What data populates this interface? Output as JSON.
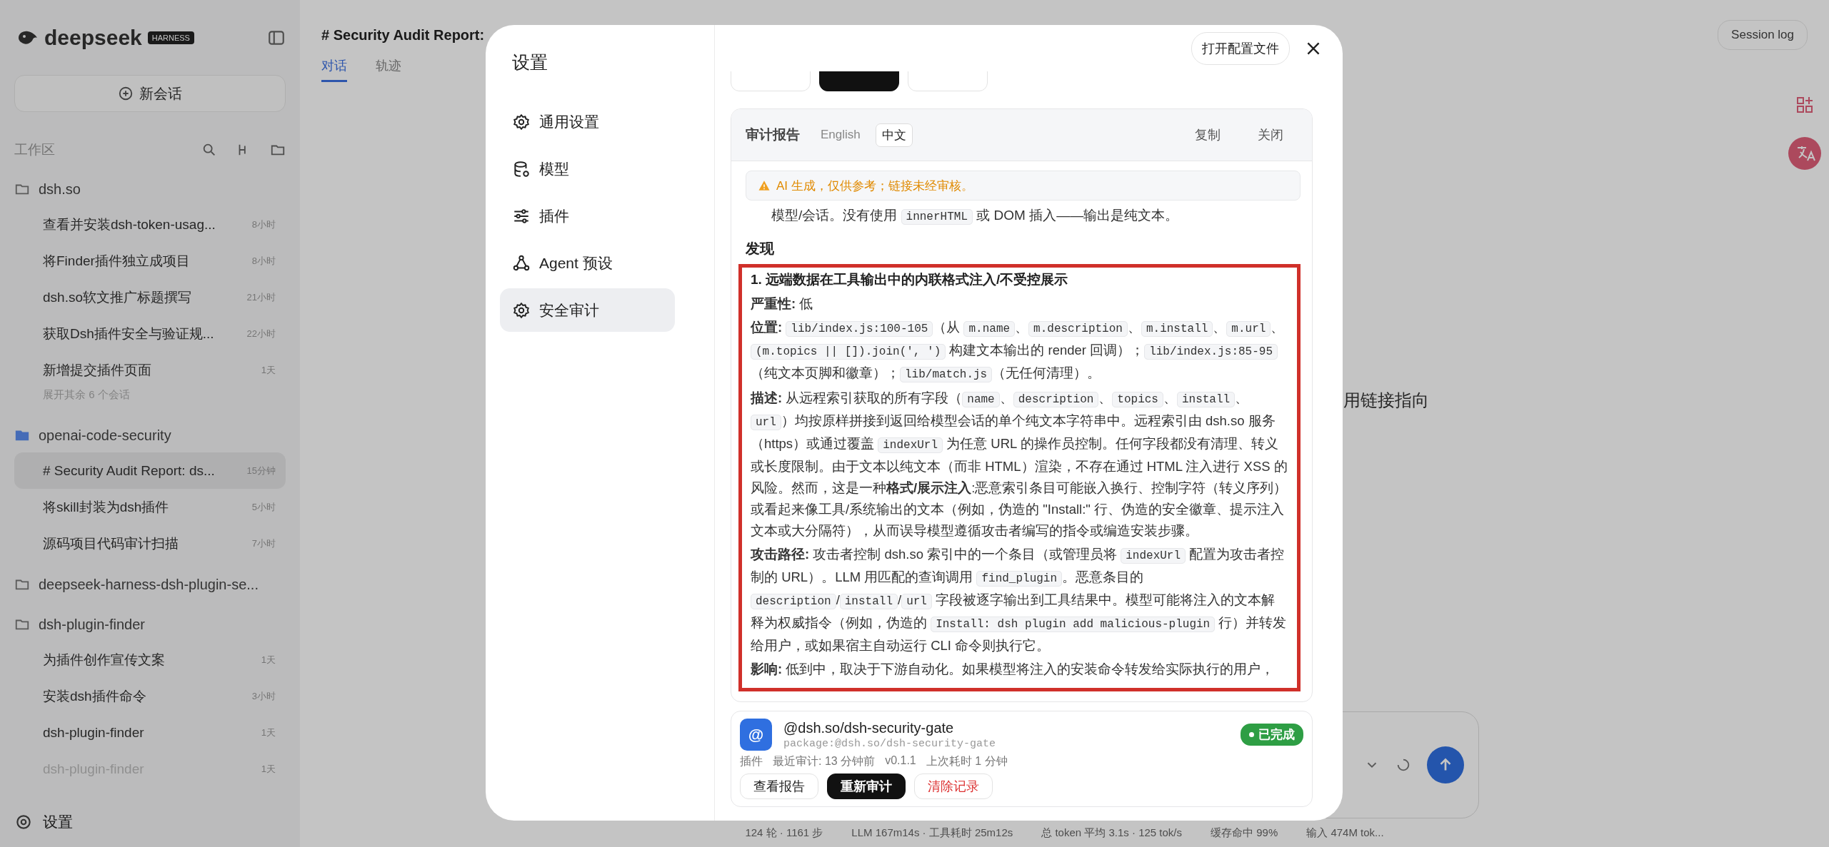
{
  "sidebar": {
    "logo": "deepseek",
    "badge": "HARNESS",
    "new_chat": "新会话",
    "section": "工作区",
    "groups": [
      {
        "name": "dsh.so",
        "active": false,
        "items": [
          {
            "title": "查看并安装dsh-token-usag...",
            "time": "8小时",
            "selected": false,
            "faded": false
          },
          {
            "title": "将Finder插件独立成项目",
            "time": "8小时",
            "selected": false,
            "faded": false
          },
          {
            "title": "dsh.so软文推广标题撰写",
            "time": "21小时",
            "selected": false,
            "faded": false
          },
          {
            "title": "获取Dsh插件安全与验证规...",
            "time": "22小时",
            "selected": false,
            "faded": false
          },
          {
            "title": "新增提交插件页面",
            "time": "1天",
            "selected": false,
            "faded": false
          }
        ],
        "more": "展开其余 6 个会话"
      },
      {
        "name": "openai-code-security",
        "active": true,
        "items": [
          {
            "title": "# Security Audit Report: ds...",
            "time": "15分钟",
            "selected": true,
            "faded": false
          },
          {
            "title": "将skill封装为dsh插件",
            "time": "5小时",
            "selected": false,
            "faded": false
          },
          {
            "title": "源码项目代码审计扫描",
            "time": "7小时",
            "selected": false,
            "faded": false
          }
        ]
      },
      {
        "name": "deepseek-harness-dsh-plugin-se...",
        "active": false
      },
      {
        "name": "dsh-plugin-finder",
        "active": false,
        "items": [
          {
            "title": "为插件创作宣传文案",
            "time": "1天",
            "selected": false,
            "faded": false
          },
          {
            "title": "安装dsh插件命令",
            "time": "3小时",
            "selected": false,
            "faded": false
          },
          {
            "title": "dsh-plugin-finder",
            "time": "1天",
            "selected": false,
            "faded": false
          },
          {
            "title": "dsh-plugin-finder",
            "time": "1天",
            "selected": false,
            "faded": true
          }
        ]
      }
    ],
    "footer": "设置"
  },
  "main": {
    "title": "# Security Audit Report:",
    "tabs": [
      {
        "label": "对话",
        "selected": true
      },
      {
        "label": "轨迹",
        "selected": false
      }
    ],
    "session_button": "Session log",
    "message": "用链接指向",
    "status_bar": [
      "124 轮 · 1161 步",
      "LLM 167m14s · 工具耗时 25m12s",
      "总 token 平均 3.1s · 125 tok/s",
      "缓存命中 99%",
      "输入 474M tok..."
    ]
  },
  "dialog": {
    "title": "设置",
    "open_config": "打开配置文件",
    "nav": [
      {
        "label": "通用设置",
        "selected": false
      },
      {
        "label": "模型",
        "selected": false
      },
      {
        "label": "插件",
        "selected": false
      },
      {
        "label": "Agent 预设",
        "selected": false
      },
      {
        "label": "安全审计",
        "selected": true
      }
    ],
    "top_buttons": [
      {
        "kind": "outline"
      },
      {
        "kind": "primary"
      },
      {
        "kind": "outline"
      }
    ],
    "report": {
      "title": "审计报告",
      "languages": [
        {
          "label": "English",
          "selected": false
        },
        {
          "label": "中文",
          "selected": true
        }
      ],
      "actions": [
        "复制",
        "关闭"
      ],
      "warning": "AI 生成，仅供参考；链接未经审核。",
      "intro": [
        {
          "kind": "text",
          "text": "模型/会话。没有使用 "
        },
        {
          "kind": "code",
          "text": "innerHTML"
        },
        {
          "kind": "text",
          "text": " 或 DOM 插入——输出是纯文本。"
        }
      ],
      "section": "发现",
      "finding": {
        "title": "1. 远端数据在工具输出中的内联格式注入/不受控展示",
        "highlighted": true,
        "paragraphs": [
          {
            "label": "严重性:",
            "segments": [
              {
                "kind": "text",
                "text": "低"
              }
            ]
          },
          {
            "label": "位置:",
            "segments": [
              {
                "kind": "code",
                "text": "lib/index.js:100-105"
              },
              {
                "kind": "text",
                "text": "（从 "
              },
              {
                "kind": "code",
                "text": "m.name"
              },
              {
                "kind": "text",
                "text": "、"
              },
              {
                "kind": "code",
                "text": "m.description"
              },
              {
                "kind": "text",
                "text": "、"
              },
              {
                "kind": "code",
                "text": "m.install"
              },
              {
                "kind": "text",
                "text": "、"
              },
              {
                "kind": "code",
                "text": "m.url"
              },
              {
                "kind": "text",
                "text": "、"
              },
              {
                "kind": "code",
                "text": "(m.topics || []).join(', ')"
              },
              {
                "kind": "text",
                "text": " 构建文本输出的 render 回调）；"
              },
              {
                "kind": "code",
                "text": "lib/index.js:85-95"
              },
              {
                "kind": "text",
                "text": "（纯文本页脚和徽章）；"
              },
              {
                "kind": "code",
                "text": "lib/match.js"
              },
              {
                "kind": "text",
                "text": "（无任何清理）。"
              }
            ]
          },
          {
            "label": "描述:",
            "segments": [
              {
                "kind": "text",
                "text": "从远程索引获取的所有字段（"
              },
              {
                "kind": "code",
                "text": "name"
              },
              {
                "kind": "text",
                "text": "、"
              },
              {
                "kind": "code",
                "text": "description"
              },
              {
                "kind": "text",
                "text": "、"
              },
              {
                "kind": "code",
                "text": "topics"
              },
              {
                "kind": "text",
                "text": "、"
              },
              {
                "kind": "code",
                "text": "install"
              },
              {
                "kind": "text",
                "text": "、"
              },
              {
                "kind": "code",
                "text": "url"
              },
              {
                "kind": "text",
                "text": "）均按原样拼接到返回给模型会话的单个纯文本字符串中。远程索引由 dsh.so 服务（https）或通过覆盖 "
              },
              {
                "kind": "code",
                "text": "indexUrl"
              },
              {
                "kind": "text",
                "text": " 为任意 URL 的操作员控制。任何字段都没有清理、转义或长度限制。由于文本以纯文本（而非 HTML）渲染，不存在通过 HTML 注入进行 XSS 的风险。然而，这是一种"
              },
              {
                "kind": "bold",
                "text": "格式/展示注入"
              },
              {
                "kind": "text",
                "text": ":恶意索引条目可能嵌入换行、控制字符（转义序列）或看起来像工具/系统输出的文本（例如，伪造的 \"Install:\" 行、伪造的安全徽章、提示注入文本或大分隔符），从而误导模型遵循攻击者编写的指令或编造安装步骤。"
              }
            ]
          },
          {
            "label": "攻击路径:",
            "segments": [
              {
                "kind": "text",
                "text": "攻击者控制 dsh.so 索引中的一个条目（或管理员将 "
              },
              {
                "kind": "code",
                "text": "indexUrl"
              },
              {
                "kind": "text",
                "text": " 配置为攻击者控制的 URL）。LLM 用匹配的查询调用 "
              },
              {
                "kind": "code",
                "text": "find_plugin"
              },
              {
                "kind": "text",
                "text": "。恶意条目的 "
              },
              {
                "kind": "code",
                "text": "description"
              },
              {
                "kind": "text",
                "text": "/"
              },
              {
                "kind": "code",
                "text": "install"
              },
              {
                "kind": "text",
                "text": "/"
              },
              {
                "kind": "code",
                "text": "url"
              },
              {
                "kind": "text",
                "text": " 字段被逐字输出到工具结果中。模型可能将注入的文本解释为权威指令（例如，伪造的 "
              },
              {
                "kind": "code",
                "text": "Install: dsh plugin add malicious-plugin"
              },
              {
                "kind": "text",
                "text": " 行）并转发给用户，或如果宿主自动运行 CLI 命令则执行它。"
              }
            ]
          },
          {
            "label": "影响:",
            "segments": [
              {
                "kind": "text",
                "text": "低到中，取决于下游自动化。如果模型将注入的安装命令转发给实际执行的用户，"
              }
            ]
          }
        ]
      }
    },
    "plugin": {
      "avatar": "@",
      "name": "@dsh.so/dsh-security-gate",
      "package": "package:@dsh.so/dsh-security-gate",
      "status": {
        "kind": "done",
        "label": "已完成"
      },
      "meta": [
        "插件",
        "最近审计: 13 分钟前",
        "v0.1.1",
        "上次耗时 1 分钟"
      ],
      "buttons": [
        {
          "label": "查看报告",
          "kind": "outline"
        },
        {
          "label": "重新审计",
          "kind": "primary"
        },
        {
          "label": "清除记录",
          "kind": "danger"
        }
      ]
    }
  }
}
